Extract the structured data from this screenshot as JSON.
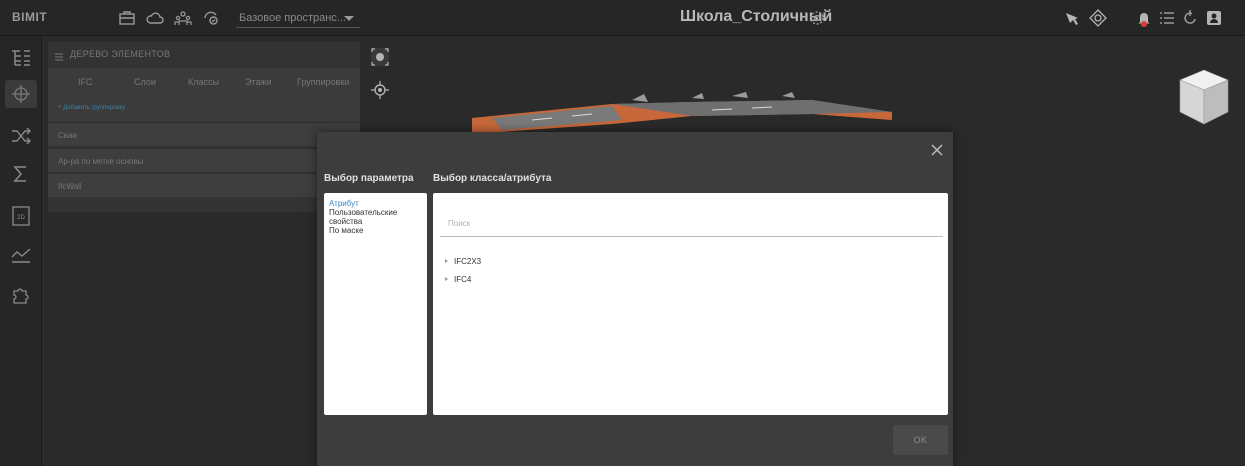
{
  "app": {
    "logo": "BIMIT",
    "workspace": "Базовое пространс...",
    "project_title": "Школа_Столичный"
  },
  "tree_panel": {
    "title": "ДЕРЕВО ЭЛЕМЕНТОВ",
    "tabs": [
      {
        "label": "IFC"
      },
      {
        "label": "Слои"
      },
      {
        "label": "Классы"
      },
      {
        "label": "Этажи"
      },
      {
        "label": "Группировки"
      }
    ],
    "add_group_label": "+ Добавить группировку",
    "rows": [
      {
        "label": "Сваи"
      },
      {
        "label": "Ар-ра по метке основы"
      },
      {
        "label": "IfcWall"
      }
    ]
  },
  "modal": {
    "param_title": "Выбор параметра",
    "class_title": "Выбор класса/атрибута",
    "params": [
      {
        "label": "Атрибут",
        "selected": true
      },
      {
        "label": "Пользовательские свойства",
        "selected": false
      },
      {
        "label": "По маске",
        "selected": false
      }
    ],
    "search_placeholder": "Поиск",
    "nodes": [
      {
        "label": "IFC2X3"
      },
      {
        "label": "IFC4"
      }
    ],
    "ok_label": "OK"
  },
  "colors": {
    "accent_blue": "#3f86c0",
    "notification": "#e03a3a",
    "building_orange": "#c8683a"
  },
  "icons": {
    "toolbar": [
      "briefcase-icon",
      "cloud-icon",
      "users-icon",
      "sync-icon"
    ],
    "right": [
      "compass-icon",
      "orbit-icon",
      "bell-icon",
      "list-icon",
      "refresh-icon",
      "user-icon"
    ],
    "sidebar": [
      "tree-structure-icon",
      "rotate-3d-icon",
      "shuffle-icon",
      "sigma-icon",
      "2d-plan-icon",
      "chart-icon",
      "puzzle-icon"
    ]
  }
}
